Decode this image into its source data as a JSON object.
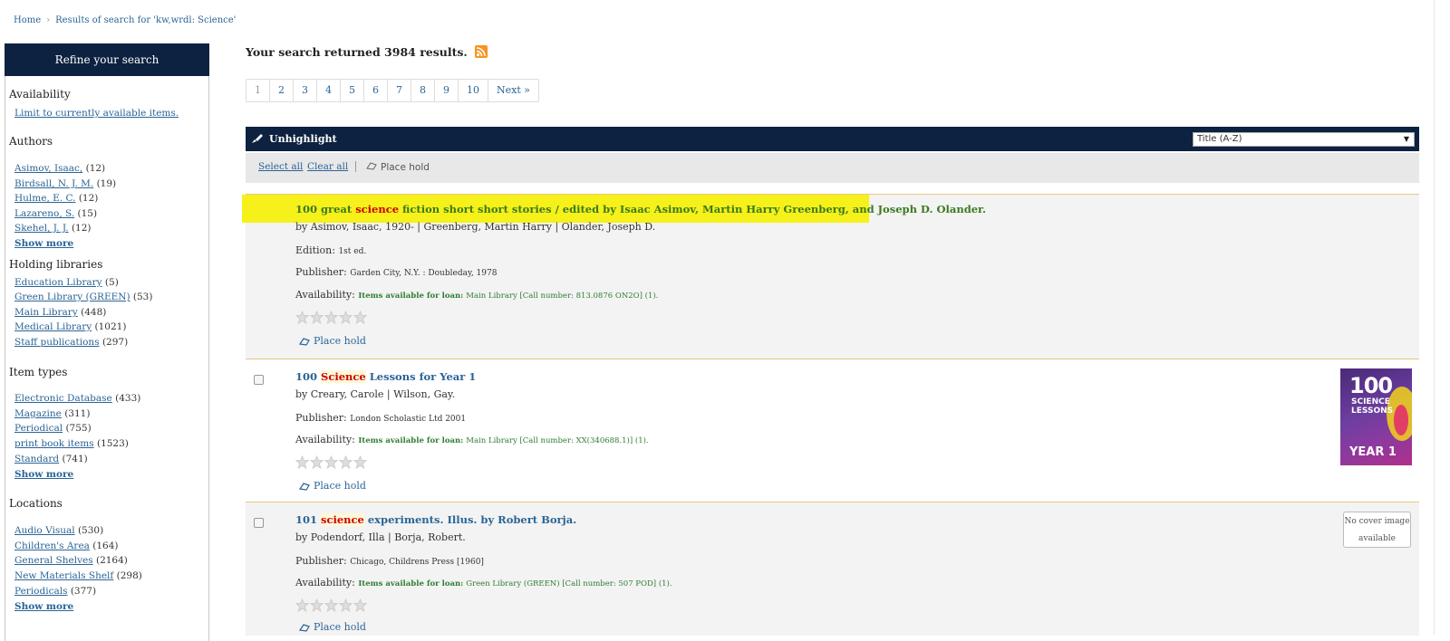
{
  "breadcrumb": {
    "home": "Home",
    "sep": "›",
    "current": "Results of search for 'kw,wrdl: Science'"
  },
  "sidebar": {
    "header": "Refine your search",
    "availability": {
      "title": "Availability",
      "link": "Limit to currently available items."
    },
    "authors": {
      "title": "Authors",
      "items": [
        {
          "label": "Asimov, Isaac,",
          "count": "(12)"
        },
        {
          "label": "Birdsall, N. J. M.",
          "count": "(19)"
        },
        {
          "label": "Hulme, E. C.",
          "count": "(12)"
        },
        {
          "label": "Lazareno, S.",
          "count": "(15)"
        },
        {
          "label": "Skehel, J. J.",
          "count": "(12)"
        }
      ],
      "more": "Show more"
    },
    "holding": {
      "title": "Holding libraries",
      "items": [
        {
          "label": "Education Library",
          "count": "(5)"
        },
        {
          "label": "Green Library (GREEN)",
          "count": "(53)"
        },
        {
          "label": "Main Library",
          "count": "(448)"
        },
        {
          "label": "Medical Library",
          "count": "(1021)"
        },
        {
          "label": "Staff publications",
          "count": "(297)"
        }
      ]
    },
    "itemtypes": {
      "title": "Item types",
      "items": [
        {
          "label": "Electronic Database",
          "count": "(433)"
        },
        {
          "label": "Magazine",
          "count": "(311)"
        },
        {
          "label": "Periodical",
          "count": "(755)"
        },
        {
          "label": "print book items",
          "count": "(1523)"
        },
        {
          "label": "Standard",
          "count": "(741)"
        }
      ],
      "more": "Show more"
    },
    "locations": {
      "title": "Locations",
      "items": [
        {
          "label": "Audio Visual",
          "count": "(530)"
        },
        {
          "label": "Children's Area",
          "count": "(164)"
        },
        {
          "label": "General Shelves",
          "count": "(2164)"
        },
        {
          "label": "New Materials Shelf",
          "count": "(298)"
        },
        {
          "label": "Periodicals",
          "count": "(377)"
        }
      ],
      "more": "Show more"
    }
  },
  "summary": "Your search returned 3984 results.",
  "pagination": [
    "1",
    "2",
    "3",
    "4",
    "5",
    "6",
    "7",
    "8",
    "9",
    "10",
    "Next »"
  ],
  "toolbar": {
    "unhighlight": "Unhighlight",
    "sort": "Title (A-Z)"
  },
  "selbar": {
    "select_all": "Select all",
    "clear_all": "Clear all",
    "place_hold": "Place hold"
  },
  "results": [
    {
      "title_pre": "100 great ",
      "title_term": "science",
      "title_post": " fiction short short stories / edited by Isaac Asimov, Martin Harry Greenberg, and Joseph D. Olander.",
      "by": "by Asimov, Isaac, 1920- | Greenberg, Martin Harry | Olander, Joseph D.",
      "edition_label": "Edition: ",
      "edition": "1st ed.",
      "publisher_label": "Publisher: ",
      "publisher": "Garden City, N.Y. : Doubleday, 1978",
      "availability_label": "Availability: ",
      "avail_status": "Items available for loan: ",
      "avail_detail": "Main Library [Call number: 813.0876 ON2O] (1).",
      "hold": "Place hold"
    },
    {
      "title_pre": "100 ",
      "title_term": "Science",
      "title_post": " Lessons for Year 1",
      "by": "by Creary, Carole | Wilson, Gay.",
      "publisher_label": "Publisher: ",
      "publisher": "London Scholastic Ltd 2001",
      "availability_label": "Availability: ",
      "avail_status": "Items available for loan: ",
      "avail_detail": "Main Library [Call number: XX(340688.1)] (1).",
      "hold": "Place hold",
      "cover": {
        "big": "100",
        "sub1": "SCIENCE",
        "sub2": "LESSONS",
        "year": "YEAR 1"
      }
    },
    {
      "title_pre": "101 ",
      "title_term": "science",
      "title_post": " experiments. Illus. by Robert Borja.",
      "by": "by Podendorf, Illa | Borja, Robert.",
      "publisher_label": "Publisher: ",
      "publisher": "Chicago, Childrens Press [1960]",
      "availability_label": "Availability: ",
      "avail_status": "Items available for loan: ",
      "avail_detail": "Green Library (GREEN) [Call number: 507 POD] (1).",
      "hold": "Place hold",
      "nocover": {
        "line1": "No cover image",
        "line2": "available"
      }
    }
  ],
  "colors": {
    "header_navy": "#0d2240",
    "link_blue": "#2a6496",
    "highlight_yellow": "#f6f11a",
    "rss_orange": "#f7931e",
    "avail_green": "#2e7d32"
  },
  "icons": {
    "rss": "rss-icon",
    "unhighlight": "highlighter-icon",
    "hold": "hold-icon",
    "star": "star-icon",
    "sort_arrow": "dropdown-arrow-icon"
  }
}
